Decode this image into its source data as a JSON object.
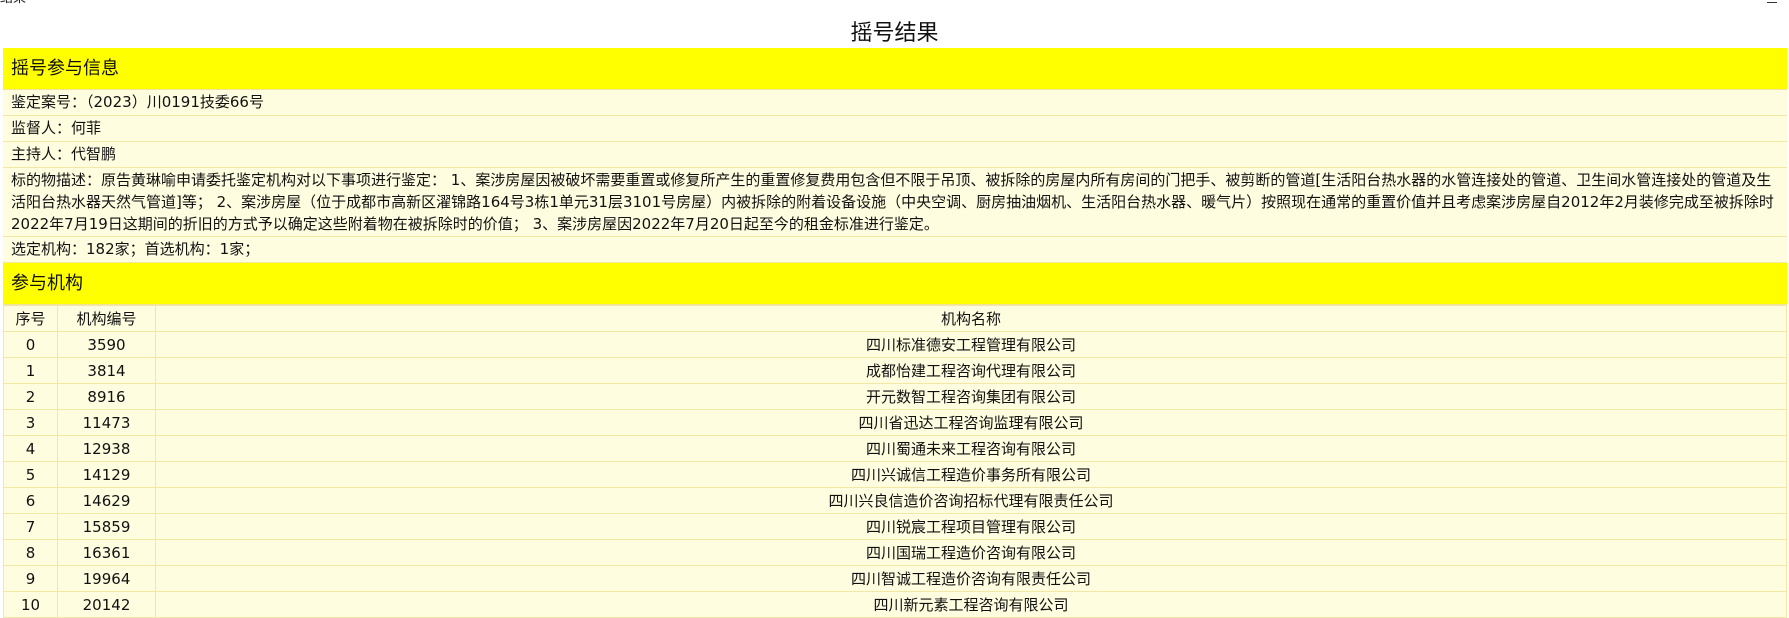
{
  "window": {
    "title": "结果"
  },
  "page": {
    "title": "摇号结果"
  },
  "info_section": {
    "header": "摇号参与信息",
    "case_number": {
      "label": "鉴定案号：",
      "value": "（2023）川0191技委66号"
    },
    "supervisor": {
      "label": "监督人：",
      "value": "何菲"
    },
    "host": {
      "label": "主持人：",
      "value": "代智鹏"
    },
    "subject": {
      "label": "标的物描述：",
      "value": "原告黄琳喻申请委托鉴定机构对以下事项进行鉴定： 1、案涉房屋因被破坏需要重置或修复所产生的重置修复费用包含但不限于吊顶、被拆除的房屋内所有房间的门把手、被剪断的管道[生活阳台热水器的水管连接处的管道、卫生间水管连接处的管道及生活阳台热水器天然气管道]等； 2、案涉房屋（位于成都市高新区濯锦路164号3栋1单元31层3101号房屋）内被拆除的附着设备设施（中央空调、厨房抽油烟机、生活阳台热水器、暖气片）按照现在通常的重置价值并且考虑案涉房屋自2012年2月装修完成至被拆除时2022年7月19日这期间的折旧的方式予以确定这些附着物在被拆除时的价值； 3、案涉房屋因2022年7月20日起至今的租金标准进行鉴定。"
    },
    "selection": {
      "label": "选定机构：",
      "value": "182家；首选机构：1家；"
    }
  },
  "org_section": {
    "header": "参与机构",
    "columns": [
      "序号",
      "机构编号",
      "机构名称"
    ],
    "rows": [
      {
        "idx": "0",
        "code": "3590",
        "name": "四川标准德安工程管理有限公司"
      },
      {
        "idx": "1",
        "code": "3814",
        "name": "成都怡建工程咨询代理有限公司"
      },
      {
        "idx": "2",
        "code": "8916",
        "name": "开元数智工程咨询集团有限公司"
      },
      {
        "idx": "3",
        "code": "11473",
        "name": "四川省迅达工程咨询监理有限公司"
      },
      {
        "idx": "4",
        "code": "12938",
        "name": "四川蜀通未来工程咨询有限公司"
      },
      {
        "idx": "5",
        "code": "14129",
        "name": "四川兴诚信工程造价事务所有限公司"
      },
      {
        "idx": "6",
        "code": "14629",
        "name": "四川兴良信造价咨询招标代理有限责任公司"
      },
      {
        "idx": "7",
        "code": "15859",
        "name": "四川锐宸工程项目管理有限公司"
      },
      {
        "idx": "8",
        "code": "16361",
        "name": "四川国瑞工程造价咨询有限公司"
      },
      {
        "idx": "9",
        "code": "19964",
        "name": "四川智诚工程造价咨询有限责任公司"
      },
      {
        "idx": "10",
        "code": "20142",
        "name": "四川新元素工程咨询有限公司"
      }
    ]
  }
}
